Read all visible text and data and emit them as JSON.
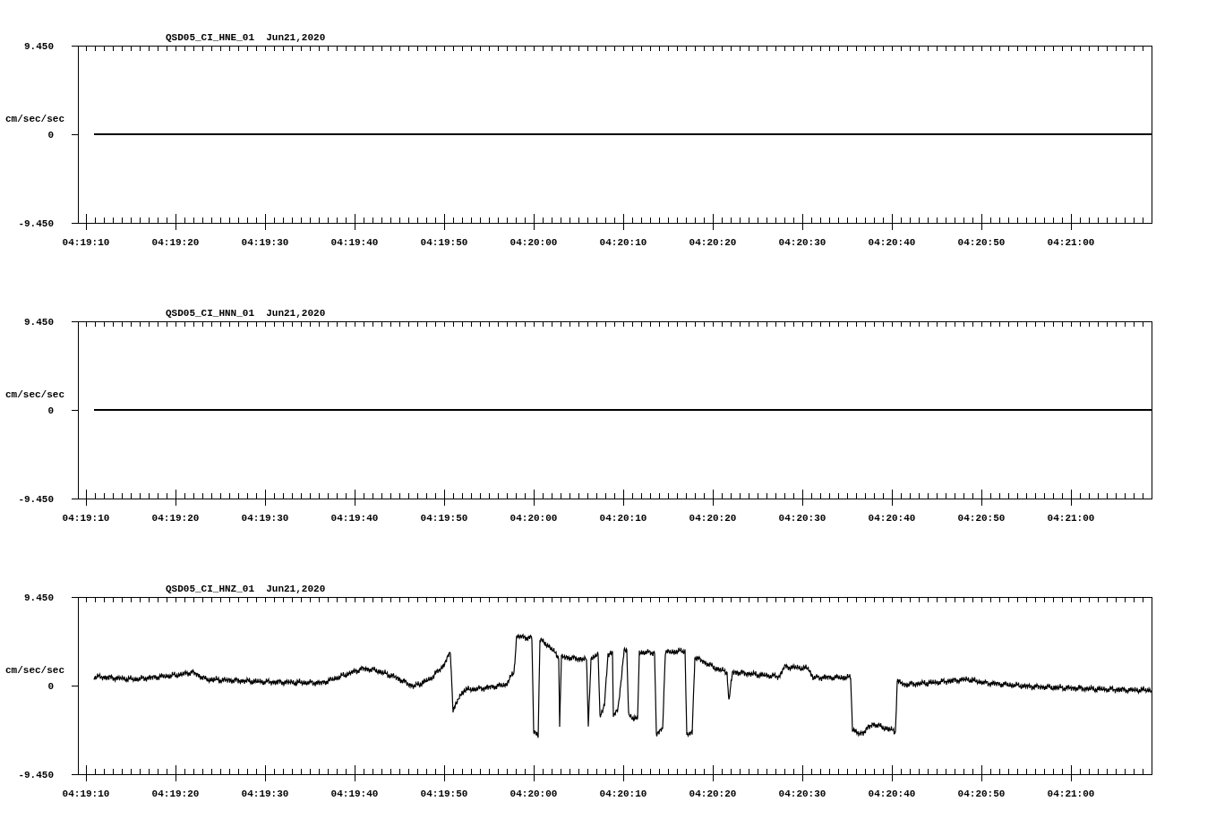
{
  "panels": [
    {
      "title": "QSD05_CI_HNE_01  Jun21,2020",
      "y_unit": "cm/sec/sec",
      "y_ticks": [
        "9.450",
        "0",
        "-9.450"
      ],
      "x_ticks": [
        "04:19:10",
        "04:19:20",
        "04:19:30",
        "04:19:40",
        "04:19:50",
        "04:20:00",
        "04:20:10",
        "04:20:20",
        "04:20:30",
        "04:20:40",
        "04:20:50",
        "04:21:00"
      ],
      "trace": {
        "kind": "flat"
      }
    },
    {
      "title": "QSD05_CI_HNN_01  Jun21,2020",
      "y_unit": "cm/sec/sec",
      "y_ticks": [
        "9.450",
        "0",
        "-9.450"
      ],
      "x_ticks": [
        "04:19:10",
        "04:19:20",
        "04:19:30",
        "04:19:40",
        "04:19:50",
        "04:20:00",
        "04:20:10",
        "04:20:20",
        "04:20:30",
        "04:20:40",
        "04:20:50",
        "04:21:00"
      ],
      "trace": {
        "kind": "flat"
      }
    },
    {
      "title": "QSD05_CI_HNZ_01  Jun21,2020",
      "y_unit": "cm/sec/sec",
      "y_ticks": [
        "9.450",
        "0",
        "-9.450"
      ],
      "x_ticks": [
        "04:19:10",
        "04:19:20",
        "04:19:30",
        "04:19:40",
        "04:19:50",
        "04:20:00",
        "04:20:10",
        "04:20:20",
        "04:20:30",
        "04:20:40",
        "04:20:50",
        "04:21:00"
      ],
      "trace": {
        "kind": "waveform"
      }
    }
  ]
}
